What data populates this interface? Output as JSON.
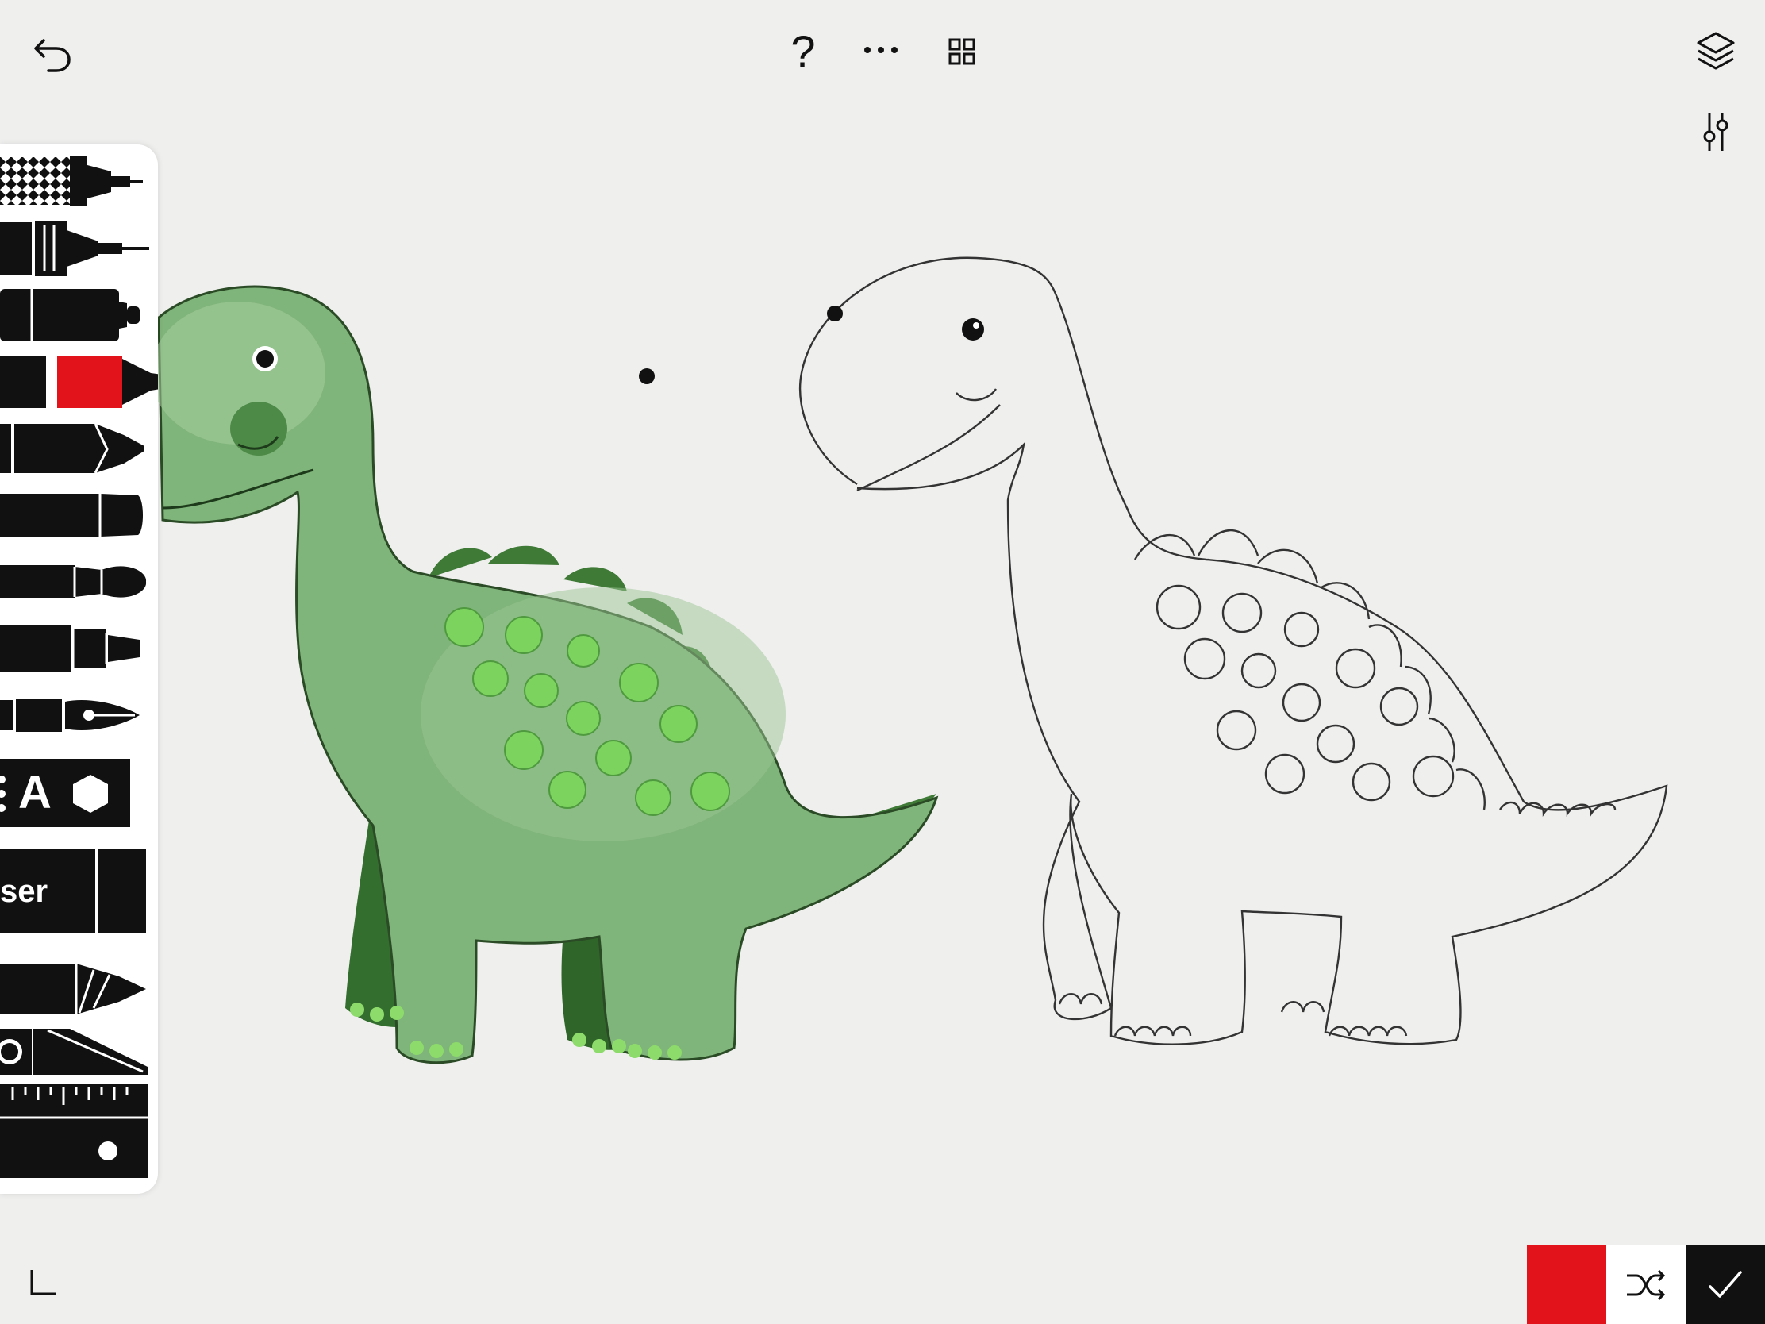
{
  "toolbar": {
    "undo_icon": "undo-arrow-icon",
    "help_label": "?",
    "more_icon": "more-dots-icon",
    "gallery_icon": "grid-icon",
    "layers_icon": "layers-icon",
    "adjust_icon": "sliders-icon",
    "corner_icon": "corner-angle-icon"
  },
  "tools": {
    "items": [
      "fineliner-pen-icon",
      "technical-pen-icon",
      "marker-icon",
      "watercolor-brush-icon",
      "crayon-icon",
      "oil-pastel-icon",
      "paint-brush-icon",
      "felt-tip-icon",
      "fountain-pen-icon",
      "text-shape-tool-icon",
      "eraser-icon",
      "pencil-icon",
      "cutter-icon",
      "ruler-icon"
    ],
    "selected": "watercolor-brush-icon",
    "text_tool_letter": "A",
    "eraser_label": "ser"
  },
  "colors": {
    "current_color": "#e3131b",
    "accent": "#e3131b",
    "dino_green": "#5f9a57",
    "dark_green": "#2f6b2a",
    "spot_green": "#7cd35e"
  },
  "bottom_bar": {
    "shuffle_icon": "shuffle-icon",
    "confirm_icon": "checkmark-icon"
  }
}
